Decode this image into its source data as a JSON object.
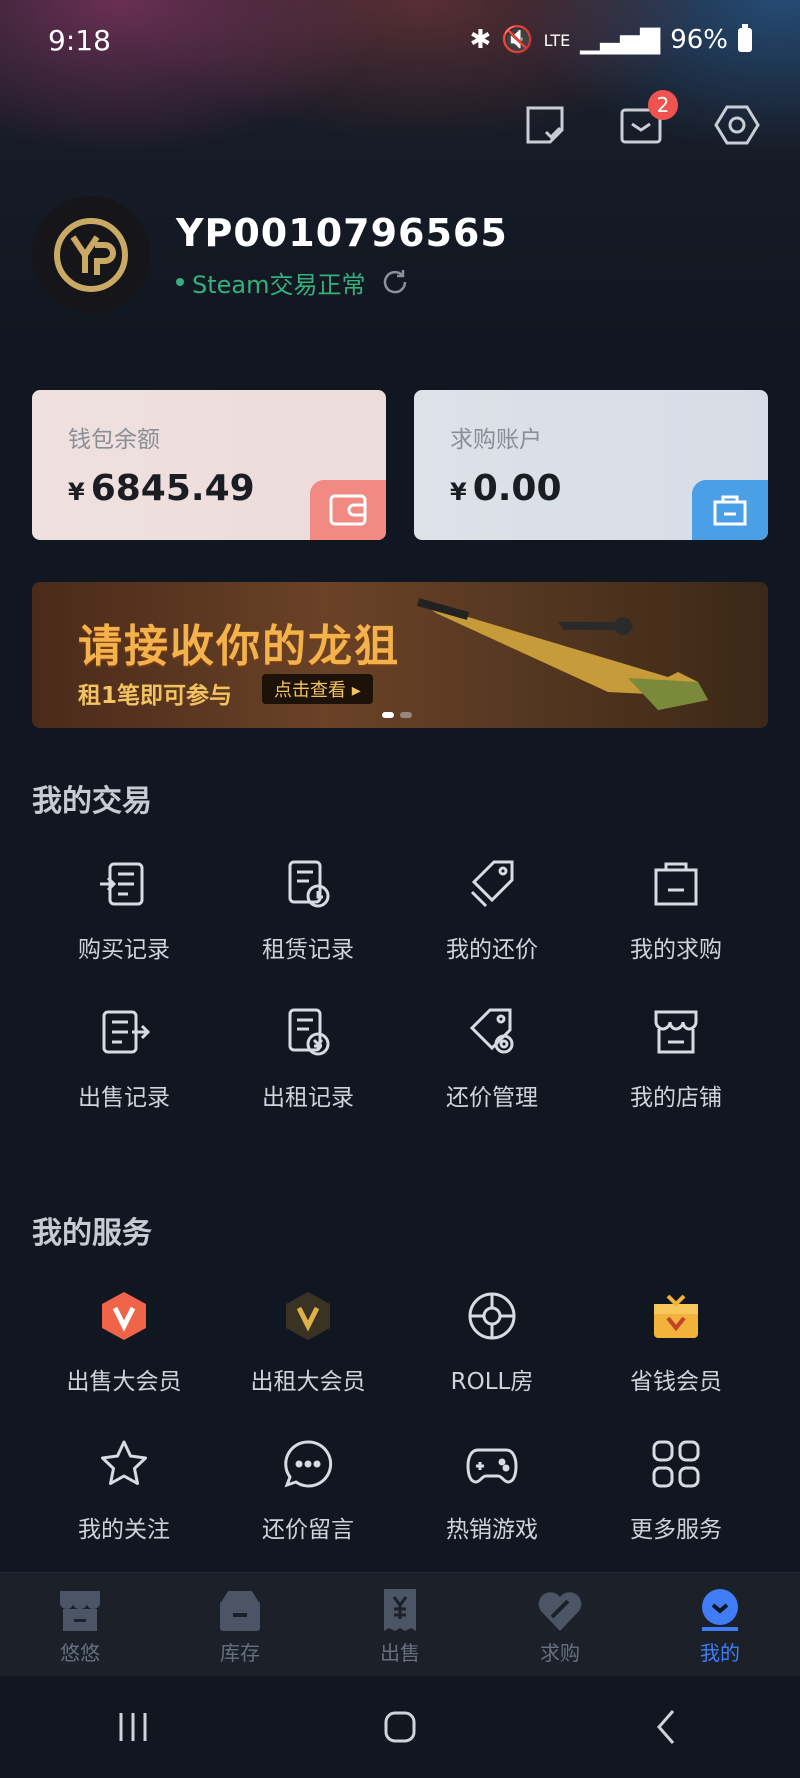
{
  "status_bar": {
    "time": "9:18",
    "network": "LTE",
    "battery": "96%"
  },
  "header": {
    "message_badge": "2"
  },
  "profile": {
    "username": "YP0010796565",
    "steam_status": "Steam交易正常"
  },
  "wallet": {
    "label": "钱包余额",
    "currency": "¥",
    "amount": "6845.49"
  },
  "buy_account": {
    "label": "求购账户",
    "currency": "¥",
    "amount": "0.00"
  },
  "banner": {
    "title": "请接收你的龙狙",
    "subtitle": "租1笔即可参与",
    "button": "点击查看 ▸"
  },
  "my_trades": {
    "title": "我的交易",
    "items": [
      {
        "label": "购买记录",
        "icon": "buy-record-icon"
      },
      {
        "label": "租赁记录",
        "icon": "lease-record-icon"
      },
      {
        "label": "我的还价",
        "icon": "my-offer-icon"
      },
      {
        "label": "我的求购",
        "icon": "my-purchase-icon"
      },
      {
        "label": "出售记录",
        "icon": "sell-record-icon"
      },
      {
        "label": "出租记录",
        "icon": "rent-record-icon"
      },
      {
        "label": "还价管理",
        "icon": "offer-manage-icon"
      },
      {
        "label": "我的店铺",
        "icon": "shop-icon"
      }
    ]
  },
  "my_services": {
    "title": "我的服务",
    "items": [
      {
        "label": "出售大会员",
        "icon": "sell-vip-icon"
      },
      {
        "label": "出租大会员",
        "icon": "rent-vip-icon"
      },
      {
        "label": "ROLL房",
        "icon": "roll-room-icon"
      },
      {
        "label": "省钱会员",
        "icon": "save-vip-icon"
      },
      {
        "label": "我的关注",
        "icon": "star-icon"
      },
      {
        "label": "还价留言",
        "icon": "chat-icon"
      },
      {
        "label": "热销游戏",
        "icon": "gamepad-icon"
      },
      {
        "label": "更多服务",
        "icon": "grid-icon"
      }
    ]
  },
  "tabbar": {
    "items": [
      {
        "label": "悠悠",
        "active": false
      },
      {
        "label": "库存",
        "active": false
      },
      {
        "label": "出售",
        "active": false
      },
      {
        "label": "求购",
        "active": false
      },
      {
        "label": "我的",
        "active": true
      }
    ]
  },
  "colors": {
    "accent": "#3f7cf5",
    "steam_ok": "#33b07b",
    "badge": "#ef5350"
  }
}
